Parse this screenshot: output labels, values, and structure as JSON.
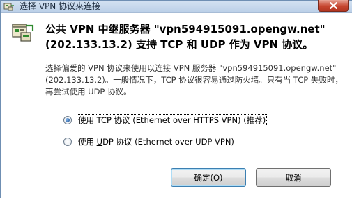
{
  "window": {
    "title": "选择 VPN 协议来连接"
  },
  "dialog": {
    "headline": "公共 VPN 中继服务器 \"vpn594915091.opengw.net\" (202.133.13.2) 支持 TCP 和 UDP 作为 VPN 协议。",
    "description": "选择偏爱的 VPN 协议来使用以连接 VPN 服务器 \"vpn594915091.opengw.net\" (202.133.13.2)。一般情况下，TCP 协议很容易通过防火墙。只有当 TCP 失败时，再尝试使用 UDP 协议。"
  },
  "options": [
    {
      "label_prefix": "使用 ",
      "accel": "T",
      "label_suffix": "CP 协议 (Ethernet over HTTPS VPN) (推荐)",
      "selected": true
    },
    {
      "label_prefix": "使用 ",
      "accel": "U",
      "label_suffix": "DP 协议 (Ethernet over UDP VPN)",
      "selected": false
    }
  ],
  "buttons": {
    "ok": "确定(O)",
    "cancel": "取消"
  },
  "icons": {
    "title": "vpn-connection-icon",
    "header": "vpn-server-icon",
    "close": "close-icon"
  },
  "colors": {
    "titlebar": "#c9daee",
    "close": "#c6452f",
    "ok_border": "#3c7fb1"
  }
}
